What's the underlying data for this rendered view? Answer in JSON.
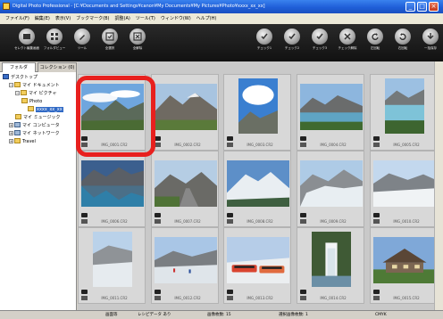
{
  "window": {
    "title": "Digital Photo Professional - [C:¥Documents and Settings¥canon¥My Documents¥My Pictures¥Photo¥xxxx_xx_xx]"
  },
  "menubar": [
    "ファイル(F)",
    "編集(E)",
    "表示(V)",
    "ブックマーク(B)",
    "調整(A)",
    "ツール(T)",
    "ウィンドウ(W)",
    "ヘルプ(H)"
  ],
  "toolbar": {
    "left": [
      {
        "icon": "select-edit-icon",
        "label": "セレクト編集画面"
      },
      {
        "icon": "folder-view-icon",
        "label": "フォルダビュー"
      },
      {
        "icon": "tool-icon",
        "label": "ツール"
      },
      {
        "icon": "select-all-icon",
        "label": "全選択"
      },
      {
        "icon": "deselect-all-icon",
        "label": "全解除"
      }
    ],
    "right": [
      {
        "icon": "check-1-icon",
        "label": "チェック1"
      },
      {
        "icon": "check-2-icon",
        "label": "チェック2"
      },
      {
        "icon": "check-3-icon",
        "label": "チェック3"
      },
      {
        "icon": "check-clear-icon",
        "label": "チェック解除"
      },
      {
        "icon": "rotate-left-icon",
        "label": "左回転"
      },
      {
        "icon": "rotate-right-icon",
        "label": "右回転"
      },
      {
        "icon": "batch-save-icon",
        "label": "一括保存"
      }
    ]
  },
  "panel": {
    "tabs": [
      "フォルダ",
      "コレクション (0)"
    ],
    "tree": [
      {
        "label": "デスクトップ",
        "icon": "desk",
        "expander": "",
        "indent": 0,
        "selected": false
      },
      {
        "label": "マイ ドキュメント",
        "icon": "folder",
        "expander": "−",
        "indent": 1,
        "selected": false
      },
      {
        "label": "マイ ピクチャ",
        "icon": "folder",
        "expander": "−",
        "indent": 2,
        "selected": false
      },
      {
        "label": "Photo",
        "icon": "folder",
        "expander": "",
        "indent": 3,
        "selected": false
      },
      {
        "label": "xxxx_xx_xx",
        "icon": "folder",
        "expander": "",
        "indent": 4,
        "selected": true
      },
      {
        "label": "マイ ミュージック",
        "icon": "folder",
        "expander": "",
        "indent": 2,
        "selected": false
      },
      {
        "label": "マイ コンピュータ",
        "icon": "comp",
        "expander": "+",
        "indent": 1,
        "selected": false
      },
      {
        "label": "マイ ネットワーク",
        "icon": "comp",
        "expander": "+",
        "indent": 1,
        "selected": false
      },
      {
        "label": "Travel",
        "icon": "folder",
        "expander": "+",
        "indent": 1,
        "selected": false
      }
    ]
  },
  "thumbnails": [
    {
      "file": "IMG_0001.CR2",
      "scene": "mountain-clouds",
      "orientation": "landscape",
      "selected": true
    },
    {
      "file": "IMG_0002.CR2",
      "scene": "mountain-valley",
      "orientation": "landscape",
      "selected": false
    },
    {
      "file": "IMG_0003.CR2",
      "scene": "sky-mountain",
      "orientation": "portrait",
      "selected": false
    },
    {
      "file": "IMG_0004.CR2",
      "scene": "lake-mountain",
      "orientation": "landscape",
      "selected": false
    },
    {
      "file": "IMG_0005.CR2",
      "scene": "lake-tall",
      "orientation": "portrait",
      "selected": false
    },
    {
      "file": "IMG_0006.CR2",
      "scene": "lake-reflection",
      "orientation": "landscape",
      "selected": false
    },
    {
      "file": "IMG_0007.CR2",
      "scene": "mountain-road",
      "orientation": "landscape",
      "selected": false
    },
    {
      "file": "IMG_0008.CR2",
      "scene": "snow-peak",
      "orientation": "landscape",
      "selected": false
    },
    {
      "file": "IMG_0009.CR2",
      "scene": "glacier-mountain",
      "orientation": "landscape",
      "selected": false
    },
    {
      "file": "IMG_0010.CR2",
      "scene": "glacier-wide",
      "orientation": "landscape",
      "selected": false
    },
    {
      "file": "IMG_0011.CR2",
      "scene": "glacier-tall",
      "orientation": "portrait",
      "selected": false
    },
    {
      "file": "IMG_0012.CR2",
      "scene": "glacier-people",
      "orientation": "landscape",
      "selected": false
    },
    {
      "file": "IMG_0013.CR2",
      "scene": "buses",
      "orientation": "landscape",
      "selected": false
    },
    {
      "file": "IMG_0014.CR2",
      "scene": "waterfall",
      "orientation": "portrait",
      "selected": false
    },
    {
      "file": "IMG_0015.CR2",
      "scene": "lodge",
      "orientation": "landscape",
      "selected": false
    }
  ],
  "statusbar": {
    "col1": "画面等",
    "col2": "レシピデータ あり",
    "col3": "画像枚数: 15",
    "col4": "選択画像枚数: 1",
    "col5": "CMYK"
  },
  "colors": {
    "title_bar": "#2a6be0",
    "highlight": "#e8201e",
    "toolbar_bg": "#1c1c1c",
    "grid_bg": "#c9c9c9"
  }
}
